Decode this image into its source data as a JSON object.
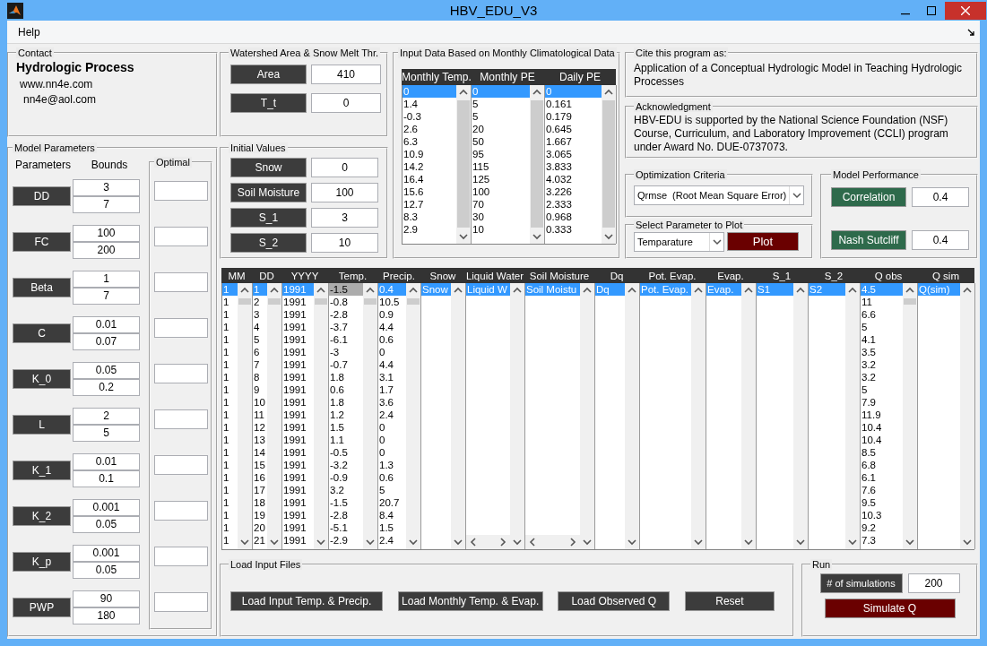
{
  "window": {
    "title": "HBV_EDU_V3"
  },
  "menu": [
    {
      "label": "Help"
    }
  ],
  "contact": {
    "title": "Contact",
    "heading": "Hydrologic Process",
    "website": "www.nn4e.com",
    "email": "nn4e@aol.com"
  },
  "model_parameters": {
    "title": "Model Parameters",
    "parameters_label": "Parameters",
    "bounds_label": "Bounds",
    "optimal_label": "Optimal",
    "rows": [
      {
        "name": "DD",
        "lower": "3",
        "upper": "7"
      },
      {
        "name": "FC",
        "lower": "100",
        "upper": "200"
      },
      {
        "name": "Beta",
        "lower": "1",
        "upper": "7"
      },
      {
        "name": "C",
        "lower": "0.01",
        "upper": "0.07"
      },
      {
        "name": "K_0",
        "lower": "0.05",
        "upper": "0.2"
      },
      {
        "name": "L",
        "lower": "2",
        "upper": "5"
      },
      {
        "name": "K_1",
        "lower": "0.01",
        "upper": "0.1"
      },
      {
        "name": "K_2",
        "lower": "0.001",
        "upper": "0.05"
      },
      {
        "name": "K_p",
        "lower": "0.001",
        "upper": "0.05"
      },
      {
        "name": "PWP",
        "lower": "90",
        "upper": "180"
      }
    ]
  },
  "watershed": {
    "title": "Watershed Area & Snow Melt Thr.",
    "fields": [
      {
        "label": "Area",
        "value": "410"
      },
      {
        "label": "T_t",
        "value": "0"
      }
    ]
  },
  "initial_values": {
    "title": "Initial Values",
    "fields": [
      {
        "label": "Snow",
        "value": "0"
      },
      {
        "label": "Soil Moisture",
        "value": "100"
      },
      {
        "label": "S_1",
        "value": "3"
      },
      {
        "label": "S_2",
        "value": "10"
      }
    ]
  },
  "input_data": {
    "title": "Input Data Based on Monthly Climatological Data",
    "columns": [
      {
        "header": "Monthly Temp.",
        "focused": true,
        "items": [
          {
            "text": "0",
            "selected": true
          },
          {
            "text": "1.4",
            "selected": false
          },
          {
            "text": "-0.3",
            "selected": false
          },
          {
            "text": "2.6",
            "selected": false
          },
          {
            "text": "6.3",
            "selected": false
          },
          {
            "text": "10.9",
            "selected": false
          },
          {
            "text": "14.2",
            "selected": false
          },
          {
            "text": "16.4",
            "selected": false
          },
          {
            "text": "15.6",
            "selected": false
          },
          {
            "text": "12.7",
            "selected": false
          },
          {
            "text": "8.3",
            "selected": false
          },
          {
            "text": "2.9",
            "selected": false
          }
        ]
      },
      {
        "header": "Monthly PE",
        "focused": true,
        "items": [
          {
            "text": "0",
            "selected": true
          },
          {
            "text": "5",
            "selected": false
          },
          {
            "text": "5",
            "selected": false
          },
          {
            "text": "20",
            "selected": false
          },
          {
            "text": "50",
            "selected": false
          },
          {
            "text": "95",
            "selected": false
          },
          {
            "text": "115",
            "selected": false
          },
          {
            "text": "125",
            "selected": false
          },
          {
            "text": "100",
            "selected": false
          },
          {
            "text": "70",
            "selected": false
          },
          {
            "text": "30",
            "selected": false
          },
          {
            "text": "10",
            "selected": false
          }
        ]
      },
      {
        "header": "Daily PE",
        "focused": true,
        "items": [
          {
            "text": "0",
            "selected": true
          },
          {
            "text": "0.161",
            "selected": false
          },
          {
            "text": "0.179",
            "selected": false
          },
          {
            "text": "0.645",
            "selected": false
          },
          {
            "text": "1.667",
            "selected": false
          },
          {
            "text": "3.065",
            "selected": false
          },
          {
            "text": "3.833",
            "selected": false
          },
          {
            "text": "4.032",
            "selected": false
          },
          {
            "text": "3.226",
            "selected": false
          },
          {
            "text": "2.333",
            "selected": false
          },
          {
            "text": "0.968",
            "selected": false
          },
          {
            "text": "0.333",
            "selected": false
          }
        ]
      }
    ]
  },
  "cite": {
    "title": "Cite this program as:",
    "text": "Application of a Conceptual Hydrologic Model in Teaching Hydrologic Processes"
  },
  "acknowledgment": {
    "title": "Acknowledgment",
    "text": "HBV-EDU is supported by the National Science Foundation (NSF) Course, Curriculum, and Laboratory Improvement (CCLI) program under Award No. DUE-0737073."
  },
  "optimization": {
    "title": "Optimization Criteria",
    "value": "Qrmse  (Root Mean Square Error)"
  },
  "plot": {
    "title": "Select Parameter to Plot",
    "value": "Temparature",
    "button": "Plot"
  },
  "performance": {
    "title": "Model Performance",
    "metrics": [
      {
        "label": "Correlation",
        "value": "0.4"
      },
      {
        "label": "Nash Sutcliff",
        "value": "0.4"
      }
    ]
  },
  "table": {
    "columns": [
      {
        "header": "MM",
        "focused": true,
        "items": [
          {
            "text": "1",
            "selected": true
          },
          {
            "text": "1",
            "selected": false
          },
          {
            "text": "1",
            "selected": false
          },
          {
            "text": "1",
            "selected": false
          },
          {
            "text": "1",
            "selected": false
          },
          {
            "text": "1",
            "selected": false
          },
          {
            "text": "1",
            "selected": false
          },
          {
            "text": "1",
            "selected": false
          },
          {
            "text": "1",
            "selected": false
          },
          {
            "text": "1",
            "selected": false
          },
          {
            "text": "1",
            "selected": false
          },
          {
            "text": "1",
            "selected": false
          },
          {
            "text": "1",
            "selected": false
          },
          {
            "text": "1",
            "selected": false
          },
          {
            "text": "1",
            "selected": false
          },
          {
            "text": "1",
            "selected": false
          },
          {
            "text": "1",
            "selected": false
          },
          {
            "text": "1",
            "selected": false
          },
          {
            "text": "1",
            "selected": false
          },
          {
            "text": "1",
            "selected": false
          },
          {
            "text": "1",
            "selected": false
          }
        ]
      },
      {
        "header": "DD",
        "focused": true,
        "items": [
          {
            "text": "1",
            "selected": true
          },
          {
            "text": "2",
            "selected": false
          },
          {
            "text": "3",
            "selected": false
          },
          {
            "text": "4",
            "selected": false
          },
          {
            "text": "5",
            "selected": false
          },
          {
            "text": "6",
            "selected": false
          },
          {
            "text": "7",
            "selected": false
          },
          {
            "text": "8",
            "selected": false
          },
          {
            "text": "9",
            "selected": false
          },
          {
            "text": "10",
            "selected": false
          },
          {
            "text": "11",
            "selected": false
          },
          {
            "text": "12",
            "selected": false
          },
          {
            "text": "13",
            "selected": false
          },
          {
            "text": "14",
            "selected": false
          },
          {
            "text": "15",
            "selected": false
          },
          {
            "text": "16",
            "selected": false
          },
          {
            "text": "17",
            "selected": false
          },
          {
            "text": "18",
            "selected": false
          },
          {
            "text": "19",
            "selected": false
          },
          {
            "text": "20",
            "selected": false
          },
          {
            "text": "21",
            "selected": false
          }
        ]
      },
      {
        "header": "YYYY",
        "focused": true,
        "items": [
          {
            "text": "1991",
            "selected": true
          },
          {
            "text": "1991",
            "selected": false
          },
          {
            "text": "1991",
            "selected": false
          },
          {
            "text": "1991",
            "selected": false
          },
          {
            "text": "1991",
            "selected": false
          },
          {
            "text": "1991",
            "selected": false
          },
          {
            "text": "1991",
            "selected": false
          },
          {
            "text": "1991",
            "selected": false
          },
          {
            "text": "1991",
            "selected": false
          },
          {
            "text": "1991",
            "selected": false
          },
          {
            "text": "1991",
            "selected": false
          },
          {
            "text": "1991",
            "selected": false
          },
          {
            "text": "1991",
            "selected": false
          },
          {
            "text": "1991",
            "selected": false
          },
          {
            "text": "1991",
            "selected": false
          },
          {
            "text": "1991",
            "selected": false
          },
          {
            "text": "1991",
            "selected": false
          },
          {
            "text": "1991",
            "selected": false
          },
          {
            "text": "1991",
            "selected": false
          },
          {
            "text": "1991",
            "selected": false
          },
          {
            "text": "1991",
            "selected": false
          }
        ]
      },
      {
        "header": "Temp.",
        "focused": false,
        "items": [
          {
            "text": "-1.5",
            "selected": true
          },
          {
            "text": "-0.8",
            "selected": false
          },
          {
            "text": "-2.8",
            "selected": false
          },
          {
            "text": "-3.7",
            "selected": false
          },
          {
            "text": "-6.1",
            "selected": false
          },
          {
            "text": "-3",
            "selected": false
          },
          {
            "text": "-0.7",
            "selected": false
          },
          {
            "text": "1.8",
            "selected": false
          },
          {
            "text": "0.6",
            "selected": false
          },
          {
            "text": "1.8",
            "selected": false
          },
          {
            "text": "1.2",
            "selected": false
          },
          {
            "text": "1.5",
            "selected": false
          },
          {
            "text": "1.1",
            "selected": false
          },
          {
            "text": "-0.5",
            "selected": false
          },
          {
            "text": "-3.2",
            "selected": false
          },
          {
            "text": "-0.9",
            "selected": false
          },
          {
            "text": "3.2",
            "selected": false
          },
          {
            "text": "-1.5",
            "selected": false
          },
          {
            "text": "-2.8",
            "selected": false
          },
          {
            "text": "-5.1",
            "selected": false
          },
          {
            "text": "-2.9",
            "selected": false
          }
        ]
      },
      {
        "header": "Precip.",
        "focused": true,
        "items": [
          {
            "text": "0.4",
            "selected": true
          },
          {
            "text": "10.5",
            "selected": false
          },
          {
            "text": "0.9",
            "selected": false
          },
          {
            "text": "4.4",
            "selected": false
          },
          {
            "text": "0.6",
            "selected": false
          },
          {
            "text": "0",
            "selected": false
          },
          {
            "text": "4.4",
            "selected": false
          },
          {
            "text": "3.1",
            "selected": false
          },
          {
            "text": "1.7",
            "selected": false
          },
          {
            "text": "3.6",
            "selected": false
          },
          {
            "text": "2.4",
            "selected": false
          },
          {
            "text": "0",
            "selected": false
          },
          {
            "text": "0",
            "selected": false
          },
          {
            "text": "0",
            "selected": false
          },
          {
            "text": "1.3",
            "selected": false
          },
          {
            "text": "0.6",
            "selected": false
          },
          {
            "text": "5",
            "selected": false
          },
          {
            "text": "20.7",
            "selected": false
          },
          {
            "text": "8.4",
            "selected": false
          },
          {
            "text": "1.5",
            "selected": false
          },
          {
            "text": "2.4",
            "selected": false
          }
        ]
      },
      {
        "header": "Snow",
        "focused": true,
        "items": [
          {
            "text": "Snow",
            "selected": true
          }
        ]
      },
      {
        "header": "Liquid Water",
        "focused": true,
        "hscroll": true,
        "items": [
          {
            "text": "Liquid W",
            "selected": true
          }
        ]
      },
      {
        "header": "Soil Moisture",
        "focused": true,
        "hscroll": true,
        "items": [
          {
            "text": "Soil Moistu",
            "selected": true
          }
        ]
      },
      {
        "header": "Dq",
        "focused": true,
        "items": [
          {
            "text": "Dq",
            "selected": true
          }
        ]
      },
      {
        "header": "Pot. Evap.",
        "focused": true,
        "items": [
          {
            "text": "Pot. Evap.",
            "selected": true
          }
        ]
      },
      {
        "header": "Evap.",
        "focused": true,
        "items": [
          {
            "text": "Evap.",
            "selected": true
          }
        ]
      },
      {
        "header": "S_1",
        "focused": true,
        "items": [
          {
            "text": "S1",
            "selected": true
          }
        ]
      },
      {
        "header": "S_2",
        "focused": true,
        "items": [
          {
            "text": "S2",
            "selected": true
          }
        ]
      },
      {
        "header": "Q obs",
        "focused": true,
        "items": [
          {
            "text": "4.5",
            "selected": true
          },
          {
            "text": "11",
            "selected": false
          },
          {
            "text": "6.6",
            "selected": false
          },
          {
            "text": "5",
            "selected": false
          },
          {
            "text": "4.1",
            "selected": false
          },
          {
            "text": "3.5",
            "selected": false
          },
          {
            "text": "3.2",
            "selected": false
          },
          {
            "text": "3.2",
            "selected": false
          },
          {
            "text": "5",
            "selected": false
          },
          {
            "text": "7.9",
            "selected": false
          },
          {
            "text": "11.9",
            "selected": false
          },
          {
            "text": "10.4",
            "selected": false
          },
          {
            "text": "10.4",
            "selected": false
          },
          {
            "text": "8.5",
            "selected": false
          },
          {
            "text": "6.8",
            "selected": false
          },
          {
            "text": "6.1",
            "selected": false
          },
          {
            "text": "7.6",
            "selected": false
          },
          {
            "text": "9.5",
            "selected": false
          },
          {
            "text": "10.3",
            "selected": false
          },
          {
            "text": "9.2",
            "selected": false
          },
          {
            "text": "7.3",
            "selected": false
          }
        ]
      },
      {
        "header": "Q sim",
        "focused": true,
        "items": [
          {
            "text": "Q(sim)",
            "selected": true
          }
        ]
      }
    ]
  },
  "load_files": {
    "title": "Load Input Files",
    "buttons": [
      "Load Input Temp. & Precip.",
      "Load Monthly Temp. & Evap.",
      "Load Observed Q",
      "Reset"
    ]
  },
  "run": {
    "title": "Run",
    "label": "# of simulations",
    "value": "200",
    "button": "Simulate Q"
  }
}
